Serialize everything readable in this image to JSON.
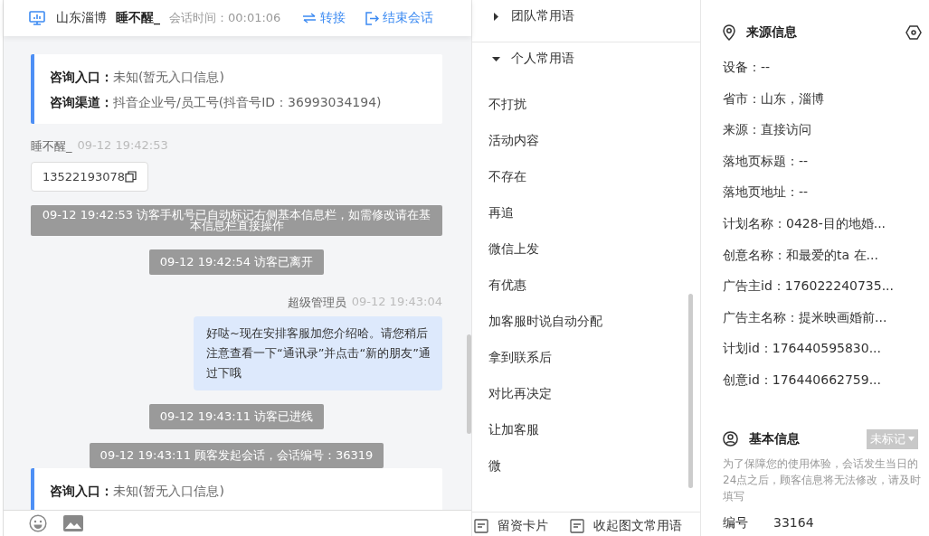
{
  "header": {
    "location": "山东淄博",
    "visitor": "睡不醒_",
    "duration_label": "会话时间：",
    "duration": "00:01:06",
    "actions": [
      {
        "label": "转接",
        "kind": "transfer"
      },
      {
        "label": "结束会话",
        "kind": "end"
      }
    ]
  },
  "messages": [
    {
      "kind": "entry",
      "rows": [
        {
          "label": "咨询入口：",
          "value": "未知(暂无入口信息)"
        },
        {
          "label": "咨询渠道：",
          "value": "抖音企业号/员工号(抖音号ID：36993034194)"
        }
      ]
    },
    {
      "kind": "visitor",
      "name": "睡不醒_",
      "time": "09-12 19:42:53",
      "text": "13522193078"
    },
    {
      "kind": "system",
      "text": "09-12 19:42:53 访客手机号已自动标记右侧基本信息栏，如需修改请在基本信息栏直接操作"
    },
    {
      "kind": "system",
      "text": "09-12 19:42:54 访客已离开"
    },
    {
      "kind": "agent",
      "name": "超级管理员",
      "time": "09-12 19:43:04",
      "text": "好哒~现在安排客服加您介绍哈。请您稍后注意查看一下“通讯录”并点击“新的朋友”通过下哦"
    },
    {
      "kind": "system",
      "text": "09-12 19:43:11 访客已进线"
    },
    {
      "kind": "system",
      "text": "09-12 19:43:11 顾客发起会话，会话编号：36319"
    },
    {
      "kind": "entry",
      "rows": [
        {
          "label": "咨询入口：",
          "value": "未知(暂无入口信息)"
        }
      ]
    }
  ],
  "phrases": {
    "groups": [
      {
        "label": "团队常用语",
        "expanded": false
      },
      {
        "label": "个人常用语",
        "expanded": true,
        "items": [
          "不打扰",
          "活动内容",
          "不存在",
          "再追",
          "微信上发",
          "有优惠",
          "加客服时说自动分配",
          "拿到联系后",
          "对比再决定",
          "让加客服",
          "微"
        ]
      }
    ],
    "footer_buttons": [
      "留资卡片",
      "收起图文常用语"
    ]
  },
  "source": {
    "title": "来源信息",
    "rows": [
      "设备：--",
      "省市：山东，淄博",
      "来源：直接访问",
      "落地页标题：--",
      "落地页地址：--",
      "计划名称：0428-目的地婚...",
      "创意名称：和最爱的ta 在...",
      "广告主id：176022240735...",
      "广告主名称：提米映画婚前...",
      "计划id：176440595830...",
      "创意id：176440662759..."
    ]
  },
  "basic": {
    "title": "基本信息",
    "tag": "未标记",
    "notice": "为了保障您的使用体验，会话发生当日的24点之后，顾客信息将无法修改，请及时填写",
    "rows": [
      {
        "label": "编号",
        "value": "33164"
      }
    ]
  }
}
